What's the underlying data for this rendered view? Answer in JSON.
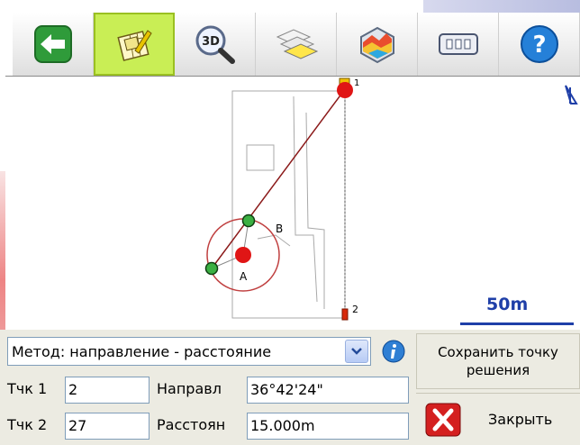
{
  "colors": {
    "accent": "#1f3fa8",
    "active_tool": "#c9ee55",
    "point_red": "#e01515",
    "point_green": "#3cb043",
    "line": "#8b1a1a"
  },
  "toolbar": {
    "buttons": [
      {
        "icon": "back-arrow-icon"
      },
      {
        "icon": "map-edit-icon",
        "active": true
      },
      {
        "icon": "3d-zoom-icon",
        "text": "3D"
      },
      {
        "icon": "layers-icon"
      },
      {
        "icon": "3d-surface-icon"
      },
      {
        "icon": "keyboard-icon"
      },
      {
        "icon": "help-icon",
        "text": "?"
      }
    ]
  },
  "map": {
    "points": {
      "p1": "1",
      "p2": "2",
      "a": "A",
      "b": "B"
    },
    "north_arrow": "north-arrow-icon",
    "scale_label": "50m"
  },
  "panel": {
    "method_value": "Метод: направление - расстояние",
    "save_button_line1": "Сохранить точку",
    "save_button_line2": "решения",
    "close_button": "Закрыть",
    "pt1_label": "Тчк 1",
    "pt1_value": "2",
    "pt2_label": "Тчк 2",
    "pt2_value": "27",
    "dir_label": "Направл",
    "dir_value": "36°42'24\"",
    "dist_label": "Расстоян",
    "dist_value": "15.000m"
  }
}
